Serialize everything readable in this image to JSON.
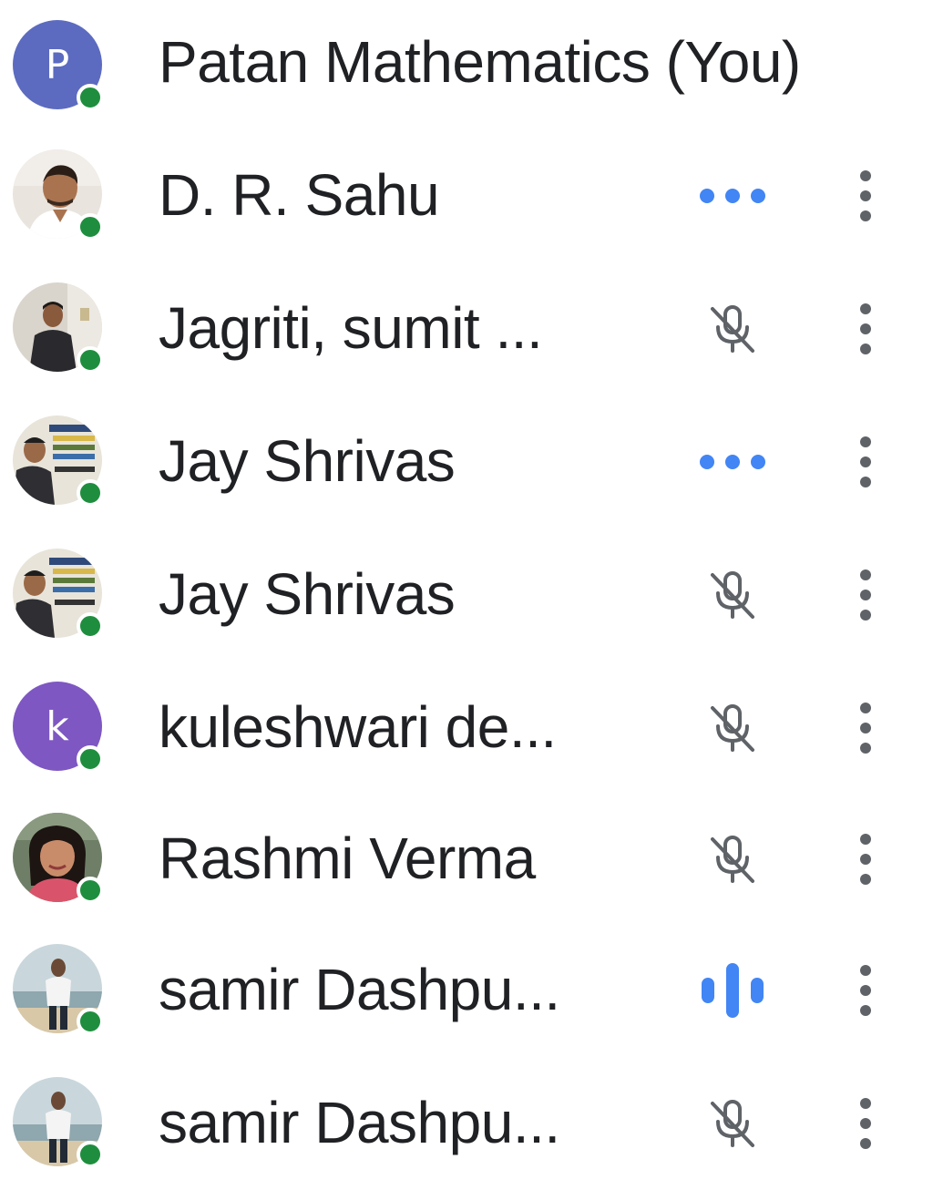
{
  "participants": [
    {
      "name": "Patan Mathematics (You)",
      "avatar": {
        "type": "letter",
        "letter": "P",
        "color": "#5c6bc0"
      },
      "online": true,
      "status": "none",
      "has_menu": false
    },
    {
      "name": "D. R. Sahu",
      "avatar": {
        "type": "photo"
      },
      "online": true,
      "status": "typing-dots",
      "has_menu": true
    },
    {
      "name": "Jagriti, sumit ...",
      "avatar": {
        "type": "photo"
      },
      "online": true,
      "status": "mic-off",
      "has_menu": true
    },
    {
      "name": "Jay Shrivas",
      "avatar": {
        "type": "photo"
      },
      "online": true,
      "status": "typing-dots",
      "has_menu": true
    },
    {
      "name": "Jay Shrivas",
      "avatar": {
        "type": "photo"
      },
      "online": true,
      "status": "mic-off",
      "has_menu": true
    },
    {
      "name": "kuleshwari de...",
      "avatar": {
        "type": "letter",
        "letter": "k",
        "color": "#7e57c2"
      },
      "online": true,
      "status": "mic-off",
      "has_menu": true
    },
    {
      "name": "Rashmi Verma",
      "avatar": {
        "type": "photo"
      },
      "online": true,
      "status": "mic-off",
      "has_menu": true
    },
    {
      "name": "samir Dashpu...",
      "avatar": {
        "type": "photo"
      },
      "online": true,
      "status": "speaking",
      "has_menu": true
    },
    {
      "name": "samir Dashpu...",
      "avatar": {
        "type": "photo"
      },
      "online": true,
      "status": "mic-off",
      "has_menu": true
    }
  ],
  "colors": {
    "accent": "#4285f4",
    "online": "#1e8e3e",
    "icon_gray": "#5f6368",
    "text": "#202124"
  },
  "icons": {
    "typing": "more-horiz-icon",
    "muted": "mic-off-icon",
    "speaking": "audio-level-icon",
    "menu": "more-vert-icon"
  }
}
